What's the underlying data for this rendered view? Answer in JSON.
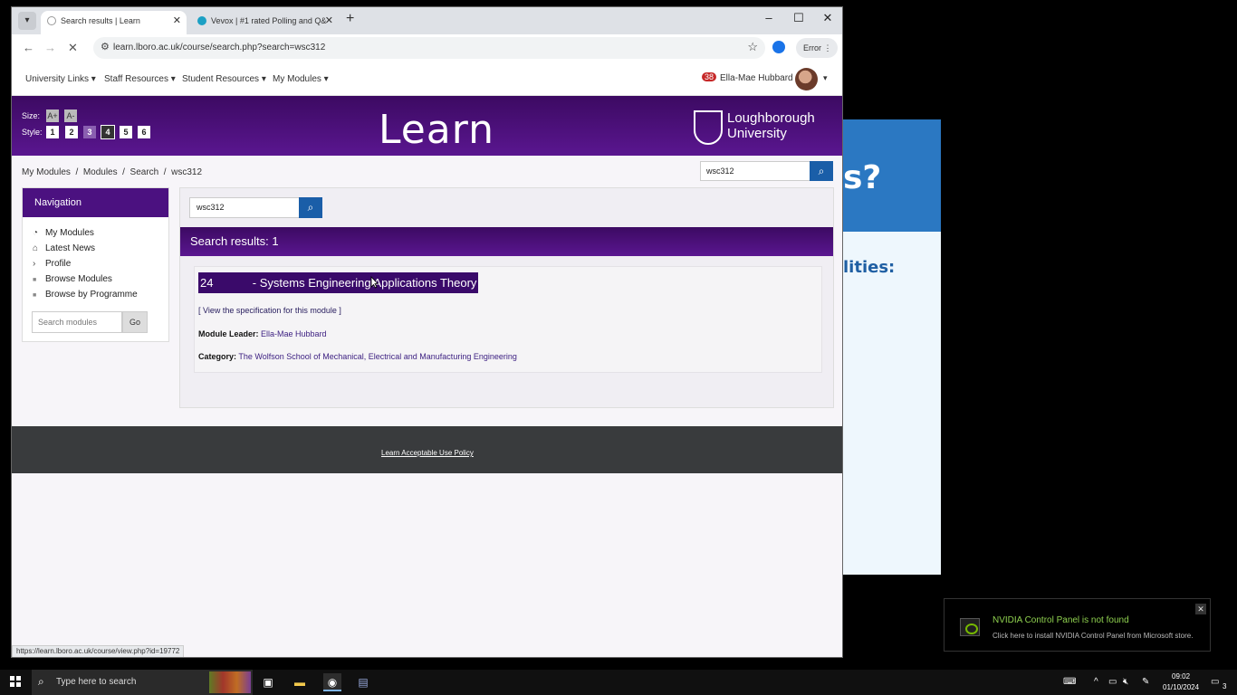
{
  "browser": {
    "tabs": [
      {
        "title": "Search results | Learn",
        "active": true
      },
      {
        "title": "Vevox | #1 rated Polling and Q&",
        "active": false
      }
    ],
    "url": "learn.lboro.ac.uk/course/search.php?search=wsc312",
    "error_label": "Error",
    "status_url": "https://learn.lboro.ac.uk/course/view.php?id=19772"
  },
  "sitenav": {
    "menus": [
      "University Links",
      "Staff Resources",
      "Student Resources",
      "My Modules"
    ],
    "notification_count": "38",
    "user_name": "Ella-Mae Hubbard"
  },
  "hero": {
    "size_label": "Size:",
    "size_buttons": [
      "A+",
      "A-"
    ],
    "style_label": "Style:",
    "style_buttons": [
      "1",
      "2",
      "3",
      "4",
      "5",
      "6"
    ],
    "title": "Learn",
    "university_line1": "Loughborough",
    "university_line2": "University"
  },
  "breadcrumb": [
    "My Modules",
    "Modules",
    "Search",
    "wsc312"
  ],
  "search": {
    "value": "wsc312"
  },
  "navigation": {
    "heading": "Navigation",
    "items": [
      "My Modules",
      "Latest News",
      "Profile",
      "Browse Modules",
      "Browse by Programme"
    ],
    "search_placeholder": "Search modules",
    "go_label": "Go"
  },
  "results": {
    "heading": "Search results: 1",
    "title": "24            - Systems Engineering Applications Theory",
    "spec_link": "[ View the specification for this module ]",
    "leader_label": "Module Leader:",
    "leader_value": "Ella-Mae Hubbard",
    "category_label": "Category:",
    "category_value": "The Wolfson School of Mechanical, Electrical and Manufacturing Engineering"
  },
  "footer": {
    "link": "Learn Acceptable Use Policy"
  },
  "background_window": {
    "heading_fragment": "s?",
    "subheading_fragment": "lities:"
  },
  "toast": {
    "title": "NVIDIA Control Panel is not found",
    "body": "Click here to install NVIDIA Control Panel from Microsoft store."
  },
  "taskbar": {
    "search_placeholder": "Type here to search",
    "time": "09:02",
    "date": "01/10/2024",
    "notification_count": "3"
  },
  "colors": {
    "brand_purple": "#4b1180",
    "search_button": "#1a5ea8",
    "footer": "#393b3d"
  }
}
